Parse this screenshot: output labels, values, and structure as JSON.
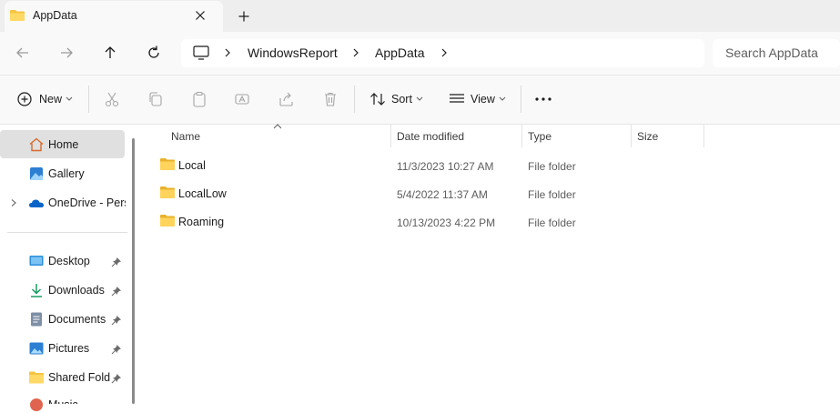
{
  "tab": {
    "title": "AppData"
  },
  "address": {
    "crumbs": [
      "WindowsReport",
      "AppData"
    ],
    "search_placeholder": "Search AppData"
  },
  "commandbar": {
    "new_label": "New",
    "sort_label": "Sort",
    "view_label": "View"
  },
  "sidebar": {
    "items": [
      {
        "label": "Home",
        "icon": "home-icon"
      },
      {
        "label": "Gallery",
        "icon": "gallery-icon"
      },
      {
        "label": "OneDrive - Perso",
        "icon": "onedrive-icon"
      },
      {
        "label": "Desktop",
        "icon": "desktop-icon"
      },
      {
        "label": "Downloads",
        "icon": "downloads-icon"
      },
      {
        "label": "Documents",
        "icon": "documents-icon"
      },
      {
        "label": "Pictures",
        "icon": "pictures-icon"
      },
      {
        "label": "Shared Folder",
        "icon": "shared-folder-icon"
      },
      {
        "label": "Music",
        "icon": "music-icon"
      }
    ]
  },
  "files": {
    "columns": [
      "Name",
      "Date modified",
      "Type",
      "Size"
    ],
    "rows": [
      {
        "name": "Local",
        "date": "11/3/2023 10:27 AM",
        "type": "File folder"
      },
      {
        "name": "LocalLow",
        "date": "5/4/2022 11:37 AM",
        "type": "File folder"
      },
      {
        "name": "Roaming",
        "date": "10/13/2023 4:22 PM",
        "type": "File folder"
      }
    ]
  },
  "colors": {
    "folder": "#f4c542",
    "accent": "#0067c0",
    "selected_bg": "#e0e0e0"
  }
}
